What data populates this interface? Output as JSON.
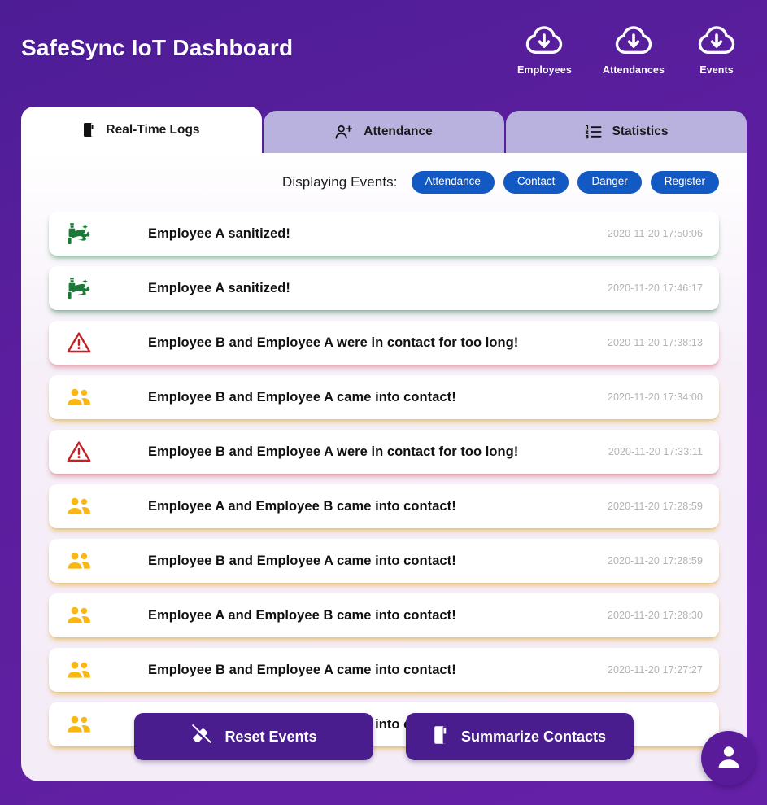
{
  "header": {
    "title": "SafeSync IoT Dashboard",
    "actions": [
      {
        "label": "Employees",
        "icon": "cloud-download-icon"
      },
      {
        "label": "Attendances",
        "icon": "cloud-download-icon"
      },
      {
        "label": "Events",
        "icon": "cloud-download-icon"
      }
    ]
  },
  "tabs": [
    {
      "label": "Real-Time Logs",
      "icon": "book-icon",
      "active": true
    },
    {
      "label": "Attendance",
      "icon": "user-plus-icon",
      "active": false
    },
    {
      "label": "Statistics",
      "icon": "list-ordered-icon",
      "active": false
    }
  ],
  "filters": {
    "label": "Displaying Events:",
    "buttons": [
      {
        "label": "Attendance"
      },
      {
        "label": "Contact"
      },
      {
        "label": "Danger"
      },
      {
        "label": "Register"
      }
    ]
  },
  "events": [
    {
      "icon": "sanitizer-icon",
      "tone": "green",
      "text": "Employee A sanitized!",
      "time": "2020-11-20 17:50:06"
    },
    {
      "icon": "sanitizer-icon",
      "tone": "green",
      "text": "Employee A sanitized!",
      "time": "2020-11-20 17:46:17"
    },
    {
      "icon": "warning-icon",
      "tone": "red",
      "text": "Employee B and Employee A were in contact for too long!",
      "time": "2020-11-20 17:38:13"
    },
    {
      "icon": "people-icon",
      "tone": "amber",
      "text": "Employee B and Employee A came into contact!",
      "time": "2020-11-20 17:34:00"
    },
    {
      "icon": "warning-icon",
      "tone": "red",
      "text": "Employee B and Employee A were in contact for too long!",
      "time": "2020-11-20 17:33:11"
    },
    {
      "icon": "people-icon",
      "tone": "amber",
      "text": "Employee A and Employee B came into contact!",
      "time": "2020-11-20 17:28:59"
    },
    {
      "icon": "people-icon",
      "tone": "amber",
      "text": "Employee B and Employee A came into contact!",
      "time": "2020-11-20 17:28:59"
    },
    {
      "icon": "people-icon",
      "tone": "amber",
      "text": "Employee A and Employee B came into contact!",
      "time": "2020-11-20 17:28:30"
    },
    {
      "icon": "people-icon",
      "tone": "amber",
      "text": "Employee B and Employee A came into contact!",
      "time": "2020-11-20 17:27:27"
    },
    {
      "icon": "people-icon",
      "tone": "amber",
      "text": "Employee A and Employee B came into contact!",
      "time": ""
    }
  ],
  "footer": {
    "reset_label": "Reset Events",
    "summarize_label": "Summarize Contacts"
  },
  "fab": {
    "icon": "user-icon"
  },
  "colors": {
    "brand_purple": "#4a1d8f",
    "filter_blue": "#1259c4",
    "tone_green": "#1c7a38",
    "tone_red": "#c62027",
    "tone_amber": "#f9b715",
    "tab_inactive": "#b9b2de"
  }
}
